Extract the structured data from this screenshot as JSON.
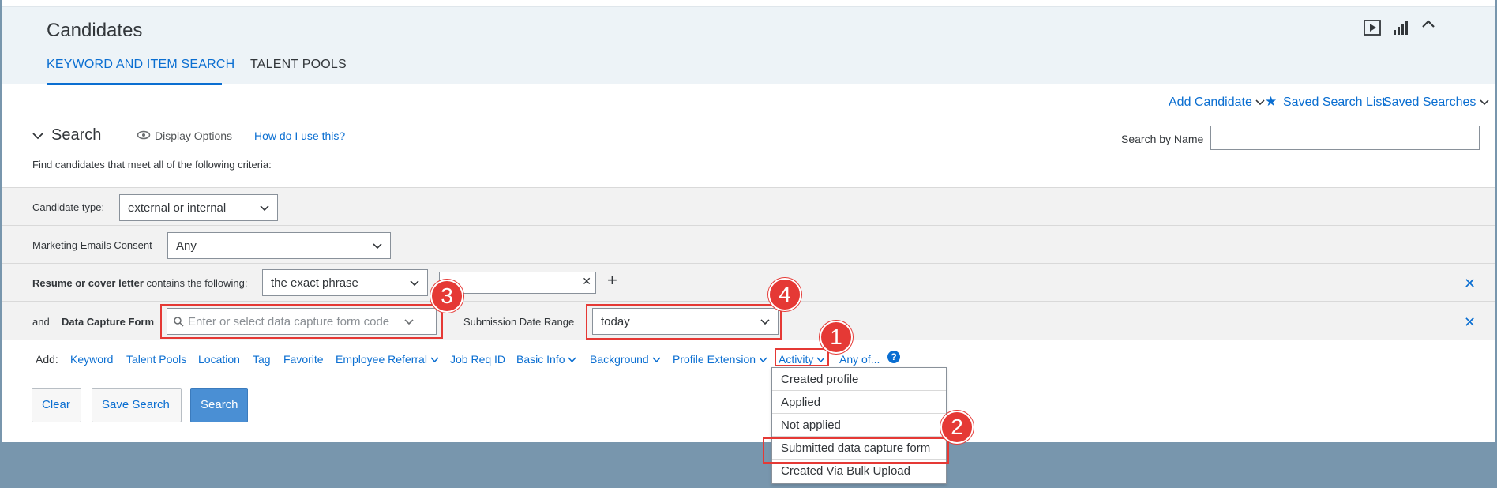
{
  "header": {
    "title": "Candidates",
    "tabs": [
      {
        "label": "KEYWORD AND ITEM SEARCH",
        "active": true
      },
      {
        "label": "TALENT POOLS",
        "active": false
      }
    ],
    "icons": [
      "play-icon",
      "chart-icon",
      "collapse-icon"
    ]
  },
  "toolbar": {
    "add_candidate": "Add Candidate",
    "saved_search_list": "Saved Search List",
    "saved_searches": "Saved Searches"
  },
  "search": {
    "title": "Search",
    "display_options": "Display Options",
    "how_to": "How do I use this?",
    "criteria_text": "Find candidates that meet all of the following criteria:",
    "search_by_name_label": "Search by Name",
    "search_by_name_value": ""
  },
  "criteria": {
    "candidate_type": {
      "label": "Candidate type:",
      "value": "external or internal"
    },
    "marketing": {
      "label": "Marketing Emails Consent",
      "value": "Any"
    },
    "resume": {
      "label_bold": "Resume or cover letter",
      "label_rest": "contains the following:",
      "match": "the exact phrase",
      "text": ""
    },
    "dcf": {
      "and": "and",
      "label": "Data Capture Form",
      "placeholder": "Enter or select data capture form code",
      "date_label": "Submission Date Range",
      "date_value": "today"
    }
  },
  "add_bar": {
    "label": "Add:",
    "links": [
      "Keyword",
      "Talent Pools",
      "Location",
      "Tag",
      "Favorite",
      "Employee Referral",
      "Job Req ID",
      "Basic Info",
      "Background",
      "Profile Extension",
      "Activity",
      "Any of..."
    ],
    "help": "?"
  },
  "buttons": {
    "clear": "Clear",
    "save_search": "Save Search",
    "search": "Search"
  },
  "activity_menu": [
    "Created profile",
    "Applied",
    "Not applied",
    "Submitted data capture form",
    "Created Via Bulk Upload"
  ],
  "annotations": [
    "1",
    "2",
    "3",
    "4"
  ],
  "colors": {
    "accent": "#0a6ed1",
    "annotation": "#e53935",
    "background": "#7896ad"
  }
}
